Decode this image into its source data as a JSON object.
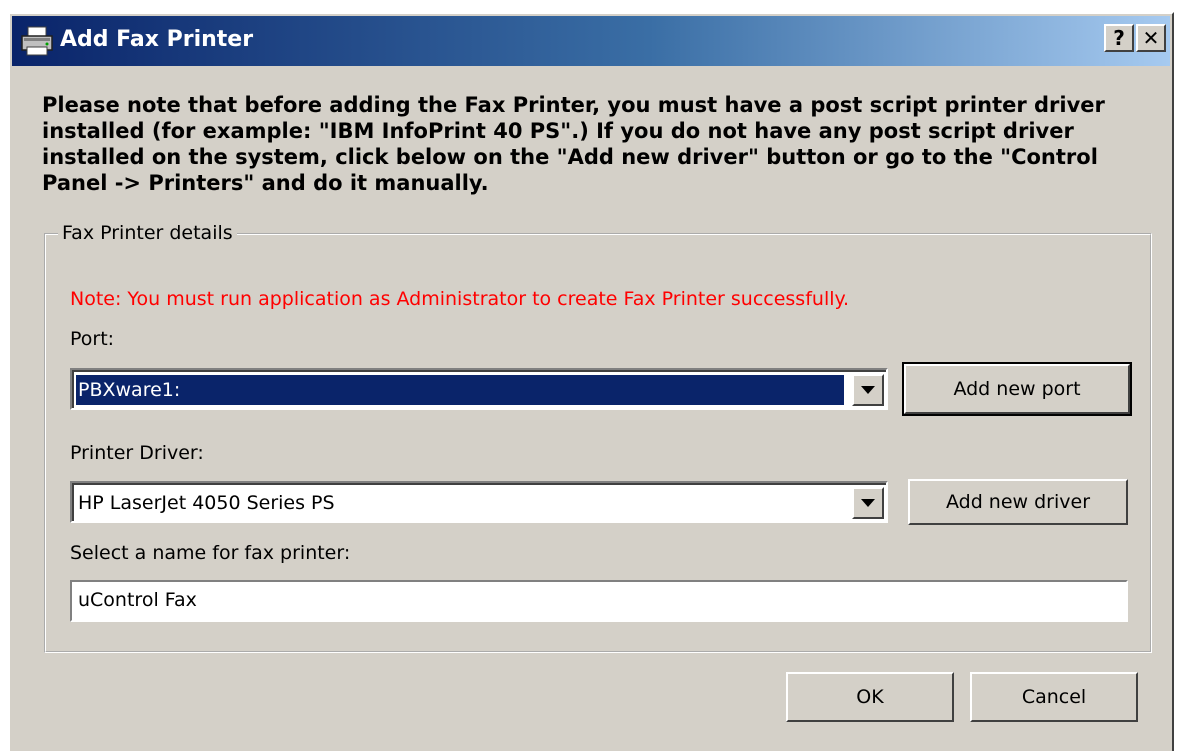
{
  "window": {
    "title": "Add Fax Printer",
    "help_label": "?",
    "close_label": "✕"
  },
  "intro_text": "Please note that before adding the Fax Printer, you must have a post script printer driver installed (for example: \"IBM InfoPrint 40 PS\".) If you do not have any post script driver installed on the system, click below on the \"Add new driver\" button or go to the \"Control Panel -> Printers\" and do it manually.",
  "group": {
    "legend": "Fax Printer details",
    "admin_note": "Note: You must run application as Administrator to create Fax Printer successfully.",
    "port": {
      "label": "Port:",
      "selected_value": "PBXware1:",
      "add_button": "Add new port"
    },
    "driver": {
      "label": "Printer Driver:",
      "selected_value": "HP LaserJet 4050 Series PS",
      "add_button": "Add new driver"
    },
    "name": {
      "label": "Select a name for fax printer:",
      "value": "uControl Fax"
    }
  },
  "footer": {
    "ok_label": "OK",
    "cancel_label": "Cancel"
  },
  "colors": {
    "dialog_bg": "#d4d0c8",
    "title_bar_start": "#0a246a",
    "title_bar_end": "#a6caf0",
    "selection_bg": "#0a246a",
    "warning_text": "#ff0000"
  },
  "icons": {
    "title": "fax-printer-icon",
    "dropdown": "chevron-down-icon"
  }
}
